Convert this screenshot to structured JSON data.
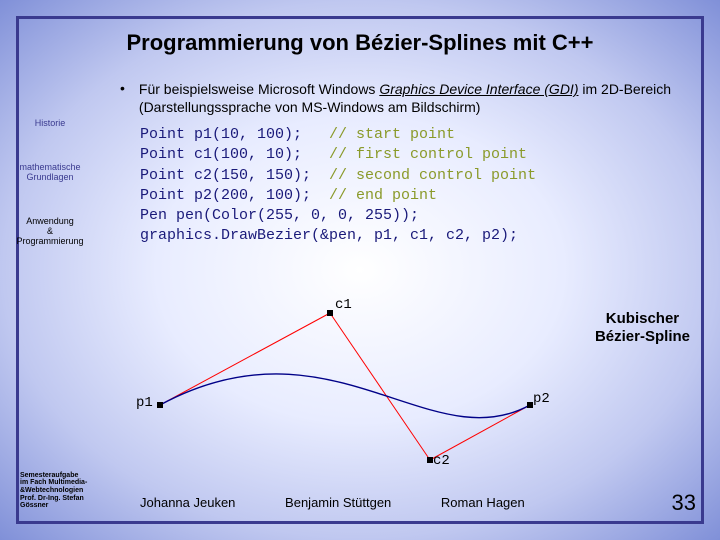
{
  "title": "Programmierung von Bézier-Splines mit C++",
  "bullet": {
    "text_before": "Für beispielsweise Microsoft Windows ",
    "gdi": "Graphics Device Interface (GDI)",
    "text_after": " im 2D-Bereich (Darstellungssprache von MS-Windows am Bildschirm)"
  },
  "sidebar": {
    "i0": "Historie",
    "i1": "mathematische\nGrundlagen",
    "i2": "Anwendung\n&\nProgrammierung"
  },
  "code": {
    "l1a": "Point p1(10, 100);   ",
    "l1c": "// start point",
    "l2a": "Point c1(100, 10);   ",
    "l2c": "// first control point",
    "l3a": "Point c2(150, 150);  ",
    "l3c": "// second control point",
    "l4a": "Point p2(200, 100);  ",
    "l4c": "// end point",
    "l5": "Pen pen(Color(255, 0, 0, 255));",
    "l6": "graphics.DrawBezier(&pen, p1, c1, c2, p2);"
  },
  "diagram": {
    "p1": "p1",
    "p2": "p2",
    "c1": "c1",
    "c2": "c2"
  },
  "caption": "Kubischer\nBézier-Spline",
  "corner": "Semesteraufgabe\nim Fach Multimedia-\n&Webtechnologien\nProf. Dr-Ing. Stefan\nGössner",
  "authors": {
    "a1": "Johanna Jeuken",
    "a2": "Benjamin Stüttgen",
    "a3": "Roman Hagen"
  },
  "page": "33",
  "chart_data": {
    "type": "line",
    "title": "Kubischer Bézier-Spline",
    "xlabel": "",
    "ylabel": "",
    "points": {
      "p1": [
        10,
        100
      ],
      "c1": [
        100,
        10
      ],
      "c2": [
        150,
        150
      ],
      "p2": [
        200,
        100
      ]
    },
    "xlim": [
      0,
      210
    ],
    "ylim": [
      0,
      160
    ]
  }
}
